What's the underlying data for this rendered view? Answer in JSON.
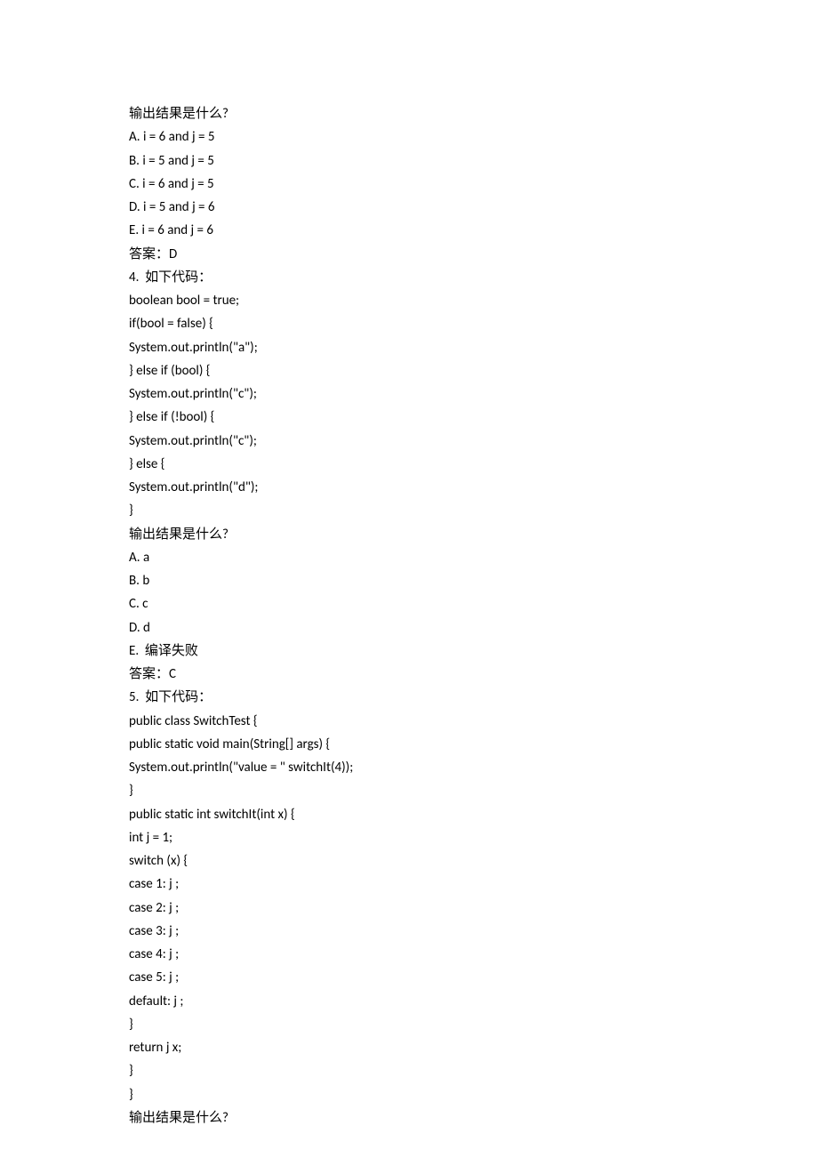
{
  "lines": [
    "输出结果是什么?",
    "A. i = 6 and j = 5",
    "B. i = 5 and j = 5",
    "C. i = 6 and j = 5",
    "D. i = 5 and j = 6",
    "E. i = 6 and j = 6",
    "答案：D",
    "4.  如下代码：",
    "boolean bool = true;",
    "if(bool = false) {",
    "System.out.println(\"a\");",
    "} else if (bool) {",
    "System.out.println(\"c\");",
    "} else if (!bool) {",
    "System.out.println(\"c\");",
    "} else {",
    "System.out.println(\"d\");",
    "}",
    "输出结果是什么?",
    "A. a",
    "B. b",
    "C. c",
    "D. d",
    "E.  编译失败",
    "答案：C",
    "5.  如下代码：",
    "public class SwitchTest {",
    "public static void main(String[] args) {",
    "System.out.println(\"value = \" switchIt(4));",
    "}",
    "public static int switchIt(int x) {",
    "int j = 1;",
    "switch (x) {",
    "case 1: j ;",
    "case 2: j ;",
    "case 3: j ;",
    "case 4: j ;",
    "case 5: j ;",
    "default: j ;",
    "}",
    "return j x;",
    "}",
    "}",
    "输出结果是什么?"
  ]
}
